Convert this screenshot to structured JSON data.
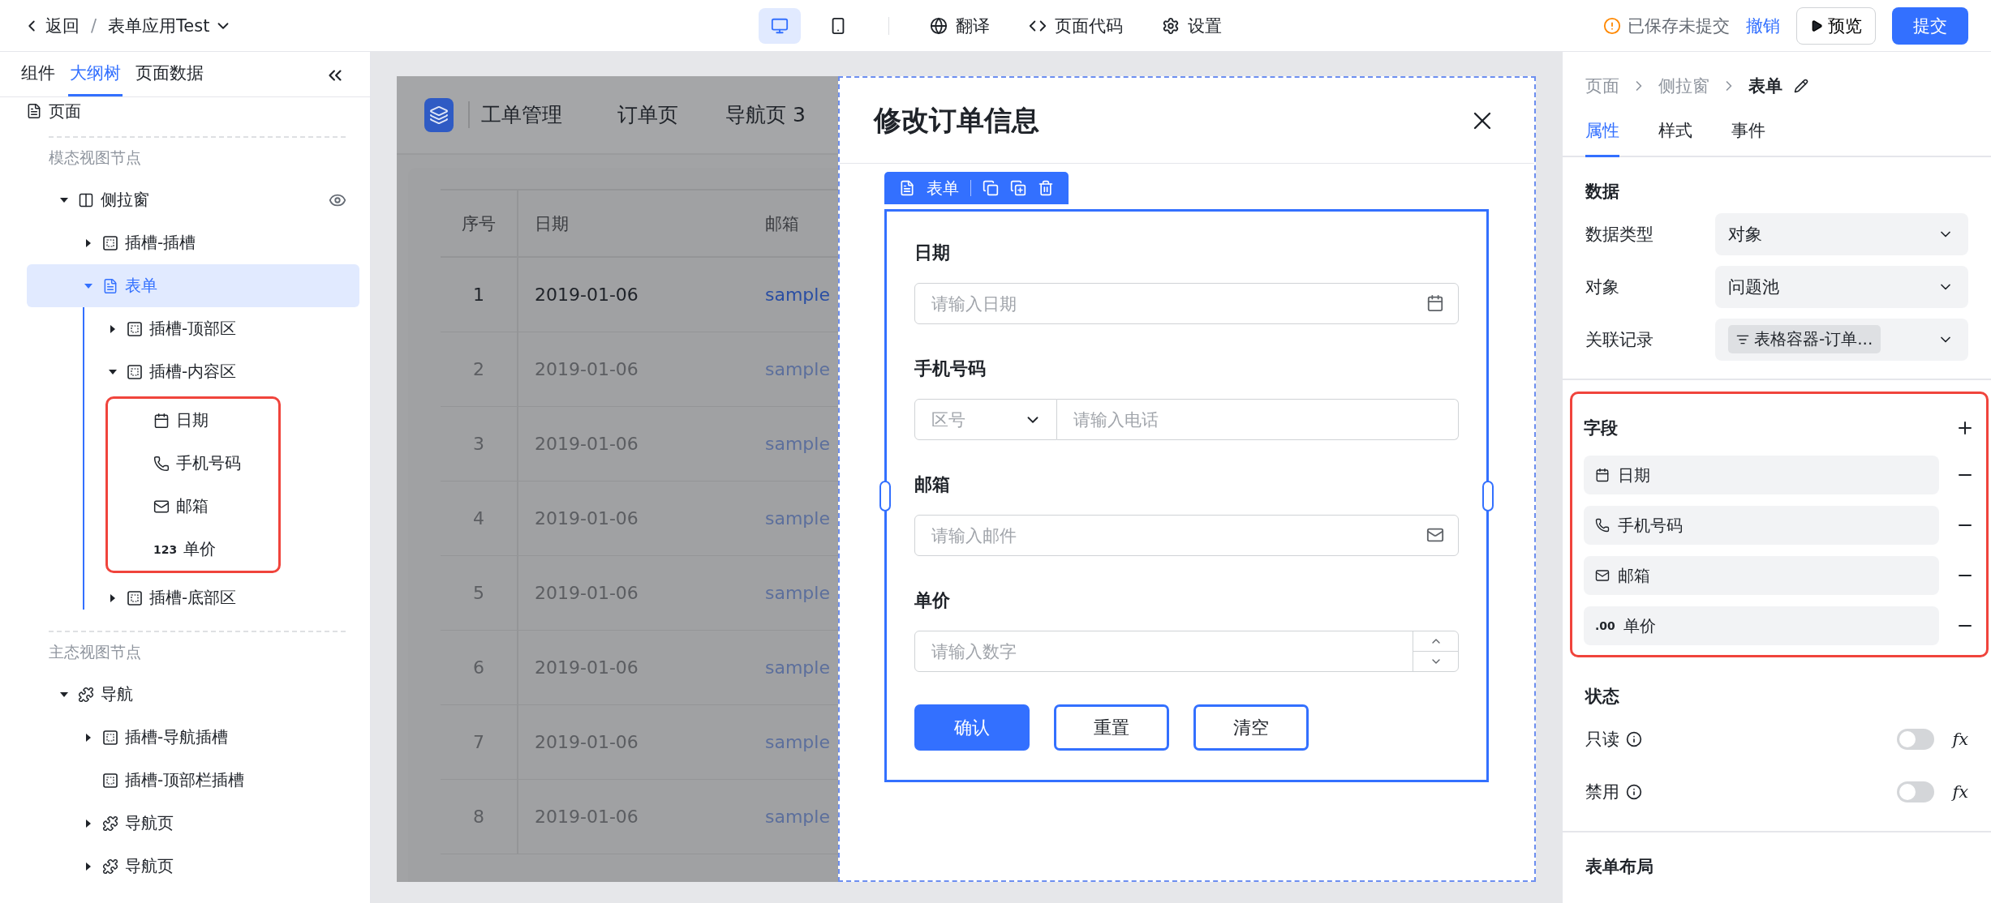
{
  "topbar": {
    "back": "返回",
    "separator": "/",
    "app_title": "表单应用Test",
    "device_modes": [
      {
        "kind": "desktop",
        "selected": true
      },
      {
        "kind": "mobile",
        "selected": false
      }
    ],
    "actions": [
      {
        "kind": "translate",
        "label": "翻译"
      },
      {
        "kind": "code",
        "label": "页面代码"
      },
      {
        "kind": "settings",
        "label": "设置"
      }
    ],
    "save_status": "已保存未提交",
    "undo": "撤销",
    "preview": "预览",
    "submit": "提交"
  },
  "left_panel": {
    "tabs": [
      {
        "label": "组件",
        "selected": false
      },
      {
        "label": "大纲树",
        "selected": true
      },
      {
        "label": "页面数据",
        "selected": false
      }
    ],
    "root": {
      "label": "页面",
      "kind": "page"
    },
    "sections": [
      {
        "title": "模态视图节点",
        "nodes": [
          {
            "label": "侧拉窗",
            "kind": "drawer",
            "selected": false,
            "expanded": true,
            "visible": true,
            "children": [
              {
                "label": "插槽-插槽",
                "kind": "slot",
                "selected": false,
                "expanded": false
              },
              {
                "label": "表单",
                "kind": "form",
                "selected": true,
                "expanded": true,
                "children": [
                  {
                    "label": "插槽-顶部区",
                    "kind": "slot",
                    "selected": false,
                    "expanded": false
                  },
                  {
                    "label": "插槽-内容区",
                    "kind": "slot",
                    "selected": false,
                    "expanded": true,
                    "highlight_children": true,
                    "children": [
                      {
                        "label": "日期",
                        "kind": "date",
                        "selected": false
                      },
                      {
                        "label": "手机号码",
                        "kind": "phone",
                        "selected": false
                      },
                      {
                        "label": "邮箱",
                        "kind": "email",
                        "selected": false
                      },
                      {
                        "label": "单价",
                        "kind": "number",
                        "icon_text": "123",
                        "selected": false
                      }
                    ]
                  },
                  {
                    "label": "插槽-底部区",
                    "kind": "slot",
                    "selected": false,
                    "expanded": false
                  }
                ]
              }
            ]
          }
        ]
      },
      {
        "title": "主态视图节点",
        "nodes": [
          {
            "label": "导航",
            "kind": "nav",
            "selected": false,
            "expanded": true,
            "children": [
              {
                "label": "插槽-导航插槽",
                "kind": "slot",
                "selected": false,
                "expanded": false
              },
              {
                "label": "插槽-顶部栏插槽",
                "kind": "slot",
                "selected": false
              },
              {
                "label": "导航页",
                "kind": "nav",
                "selected": false,
                "expanded": false
              },
              {
                "label": "导航页",
                "kind": "nav",
                "selected": false,
                "expanded": false
              }
            ]
          }
        ]
      }
    ]
  },
  "canvas": {
    "app": {
      "title": "工单管理",
      "nav": [
        "订单页",
        "导航页 3"
      ],
      "table": {
        "columns": [
          "序号",
          "日期",
          "邮箱"
        ],
        "rows": [
          {
            "cells": [
              "1",
              "2019-01-06",
              "sample"
            ],
            "selected": true
          },
          {
            "cells": [
              "2",
              "2019-01-06",
              "sample"
            ],
            "selected": false
          },
          {
            "cells": [
              "3",
              "2019-01-06",
              "sample"
            ],
            "selected": false
          },
          {
            "cells": [
              "4",
              "2019-01-06",
              "sample"
            ],
            "selected": false
          },
          {
            "cells": [
              "5",
              "2019-01-06",
              "sample"
            ],
            "selected": false
          },
          {
            "cells": [
              "6",
              "2019-01-06",
              "sample"
            ],
            "selected": false
          },
          {
            "cells": [
              "7",
              "2019-01-06",
              "sample"
            ],
            "selected": false
          },
          {
            "cells": [
              "8",
              "2019-01-06",
              "sample"
            ],
            "selected": false
          }
        ]
      }
    },
    "dialog": {
      "title": "修改订单信息",
      "toolbar_label": "表单",
      "fields": [
        {
          "label": "日期",
          "kind": "date",
          "placeholder": "请输入日期"
        },
        {
          "label": "手机号码",
          "kind": "phone",
          "area_code_placeholder": "区号",
          "placeholder": "请输入电话"
        },
        {
          "label": "邮箱",
          "kind": "email",
          "placeholder": "请输入邮件"
        },
        {
          "label": "单价",
          "kind": "number",
          "placeholder": "请输入数字"
        }
      ],
      "buttons": [
        {
          "label": "确认",
          "kind": "primary"
        },
        {
          "label": "重置",
          "kind": "outline"
        },
        {
          "label": "清空",
          "kind": "outline"
        }
      ]
    }
  },
  "right_panel": {
    "breadcrumb": [
      "页面",
      "侧拉窗",
      "表单"
    ],
    "tabs": [
      {
        "label": "属性",
        "selected": true
      },
      {
        "label": "样式",
        "selected": false
      },
      {
        "label": "事件",
        "selected": false
      }
    ],
    "data_section": {
      "title": "数据",
      "rows": [
        {
          "label": "数据类型",
          "value": "对象",
          "kind": "select"
        },
        {
          "label": "对象",
          "value": "问题池",
          "kind": "select"
        },
        {
          "label": "关联记录",
          "value": "表格容器-订单...",
          "kind": "tag"
        }
      ]
    },
    "fields_section": {
      "title": "字段",
      "highlighted": true,
      "items": [
        {
          "label": "日期",
          "kind": "date"
        },
        {
          "label": "手机号码",
          "kind": "phone"
        },
        {
          "label": "邮箱",
          "kind": "email"
        },
        {
          "label": "单价",
          "kind": "number",
          "icon_text": ".00"
        }
      ]
    },
    "state_section": {
      "title": "状态",
      "rows": [
        {
          "label": "只读",
          "on": false,
          "formula_label": "fx"
        },
        {
          "label": "禁用",
          "on": false,
          "formula_label": "fx"
        }
      ]
    },
    "layout_section": {
      "title": "表单布局"
    }
  }
}
